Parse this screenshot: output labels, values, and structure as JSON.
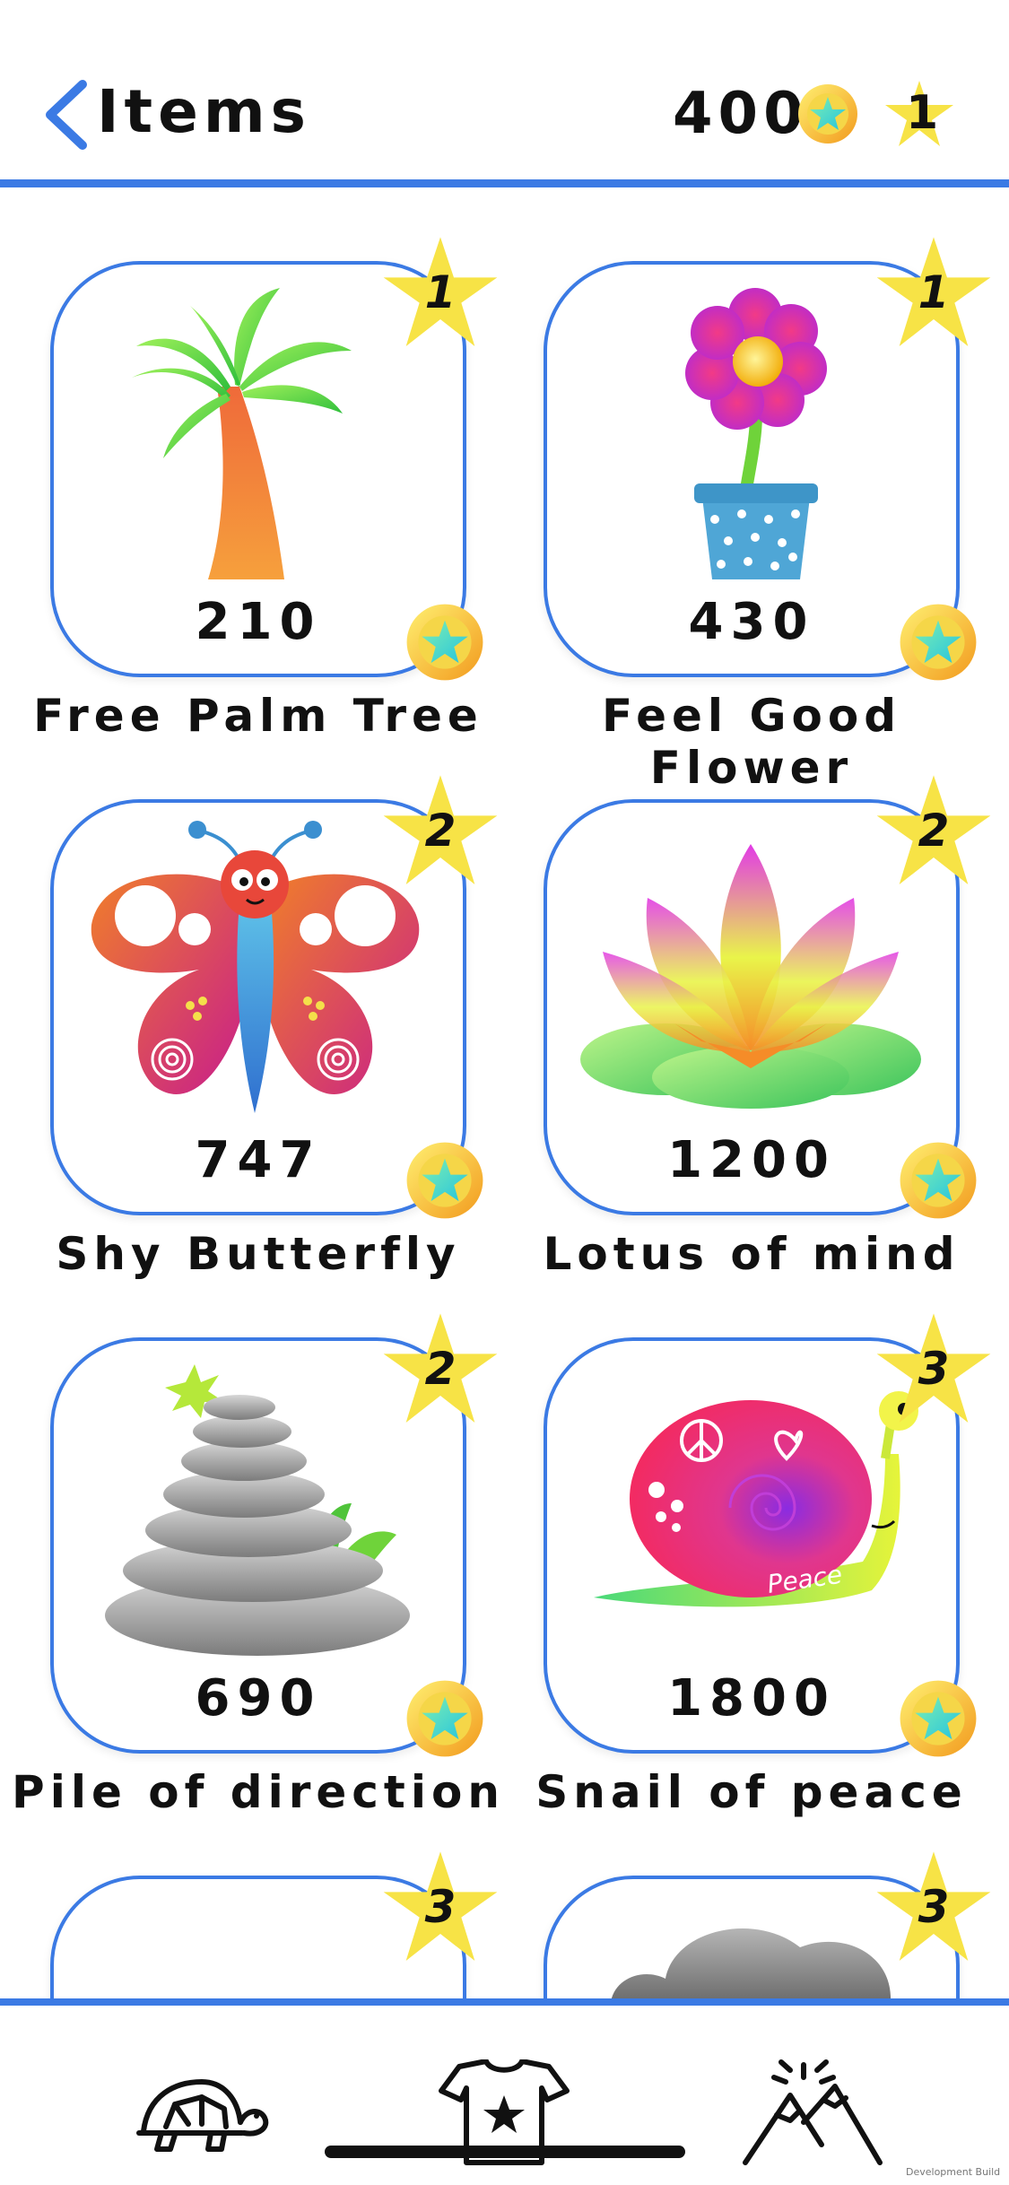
{
  "header": {
    "title": "Items",
    "coins": "400",
    "stars": "1"
  },
  "items": [
    {
      "name": "Free Palm Tree",
      "price": "210",
      "level": "1",
      "icon": "palm-tree-icon"
    },
    {
      "name": "Feel Good Flower",
      "price": "430",
      "level": "1",
      "icon": "flower-pot-icon"
    },
    {
      "name": "Shy Butterfly",
      "price": "747",
      "level": "2",
      "icon": "butterfly-icon"
    },
    {
      "name": "Lotus of mind",
      "price": "1200",
      "level": "2",
      "icon": "lotus-icon"
    },
    {
      "name": "Pile of direction",
      "price": "690",
      "level": "2",
      "icon": "stone-pile-icon"
    },
    {
      "name": "Snail of  peace",
      "price": "1800",
      "level": "3",
      "icon": "snail-icon",
      "art_text": "Peace"
    },
    {
      "level": "3"
    },
    {
      "level": "3",
      "icon": "cloud-icon"
    }
  ],
  "tabbar": {
    "tabs": [
      {
        "icon": "turtle-icon"
      },
      {
        "icon": "tshirt-star-icon"
      },
      {
        "icon": "mountain-sun-icon"
      }
    ]
  },
  "footer": {
    "build_label": "Development Build"
  },
  "colors": {
    "accent": "#3b7ae4",
    "star": "#f7e346",
    "coin": "#f6c531",
    "coin_star": "#4ed7c0"
  }
}
